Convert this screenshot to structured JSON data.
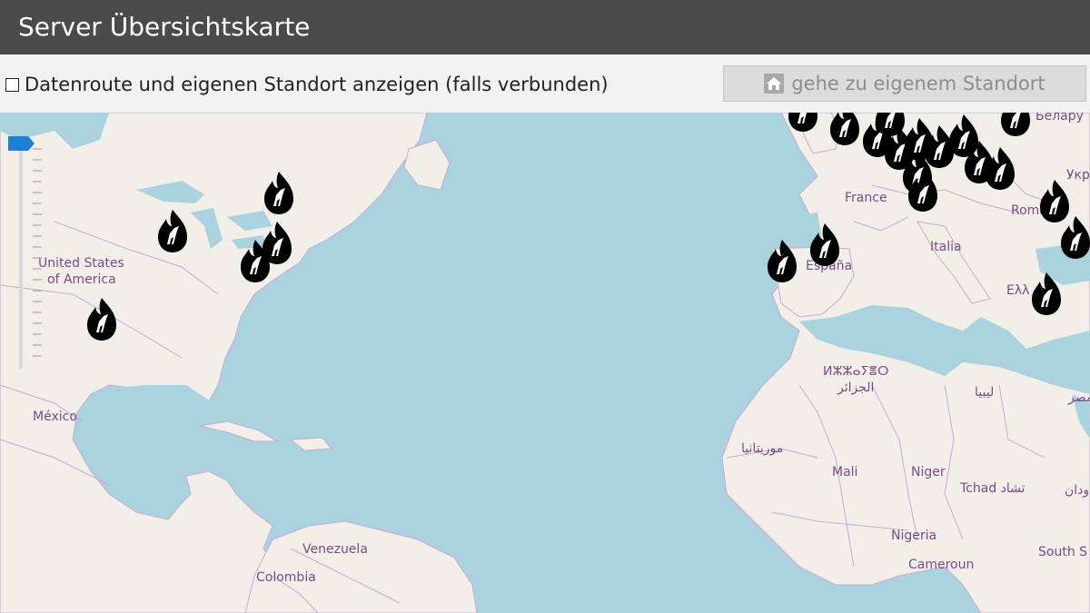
{
  "header": {
    "title": "Server Übersichtskarte"
  },
  "toolbar": {
    "checkbox_label": "Datenroute und eigenen Standort anzeigen (falls verbunden)",
    "checkbox_checked": false,
    "button_label": "gehe zu eigenem Standort",
    "button_icon": "home-icon"
  },
  "map": {
    "marker_icon": "flame-server-marker",
    "labels": {
      "usa": "United States",
      "usa2": "of America",
      "mexico": "México",
      "venezuela": "Venezuela",
      "colombia": "Colombia",
      "france": "France",
      "espana": "España",
      "italia": "Italia",
      "algeria_tifinagh": "ⵍⵣⵣⴰⵢⴻⵔ",
      "algeria_ar": "الجزائر",
      "libya": "ليبيا",
      "mauritania": "موريتانيا",
      "mali": "Mali",
      "niger": "Niger",
      "chad": "Tchad تشاد",
      "nigeria": "Nigeria",
      "cameroon": "Cameroun",
      "south_sudan": "South S",
      "sudan": "ودان",
      "egypt": "مصر",
      "belarus": "Белару",
      "ukraine": "Укр",
      "romania": "Româ",
      "greece": "Ελλ"
    }
  }
}
